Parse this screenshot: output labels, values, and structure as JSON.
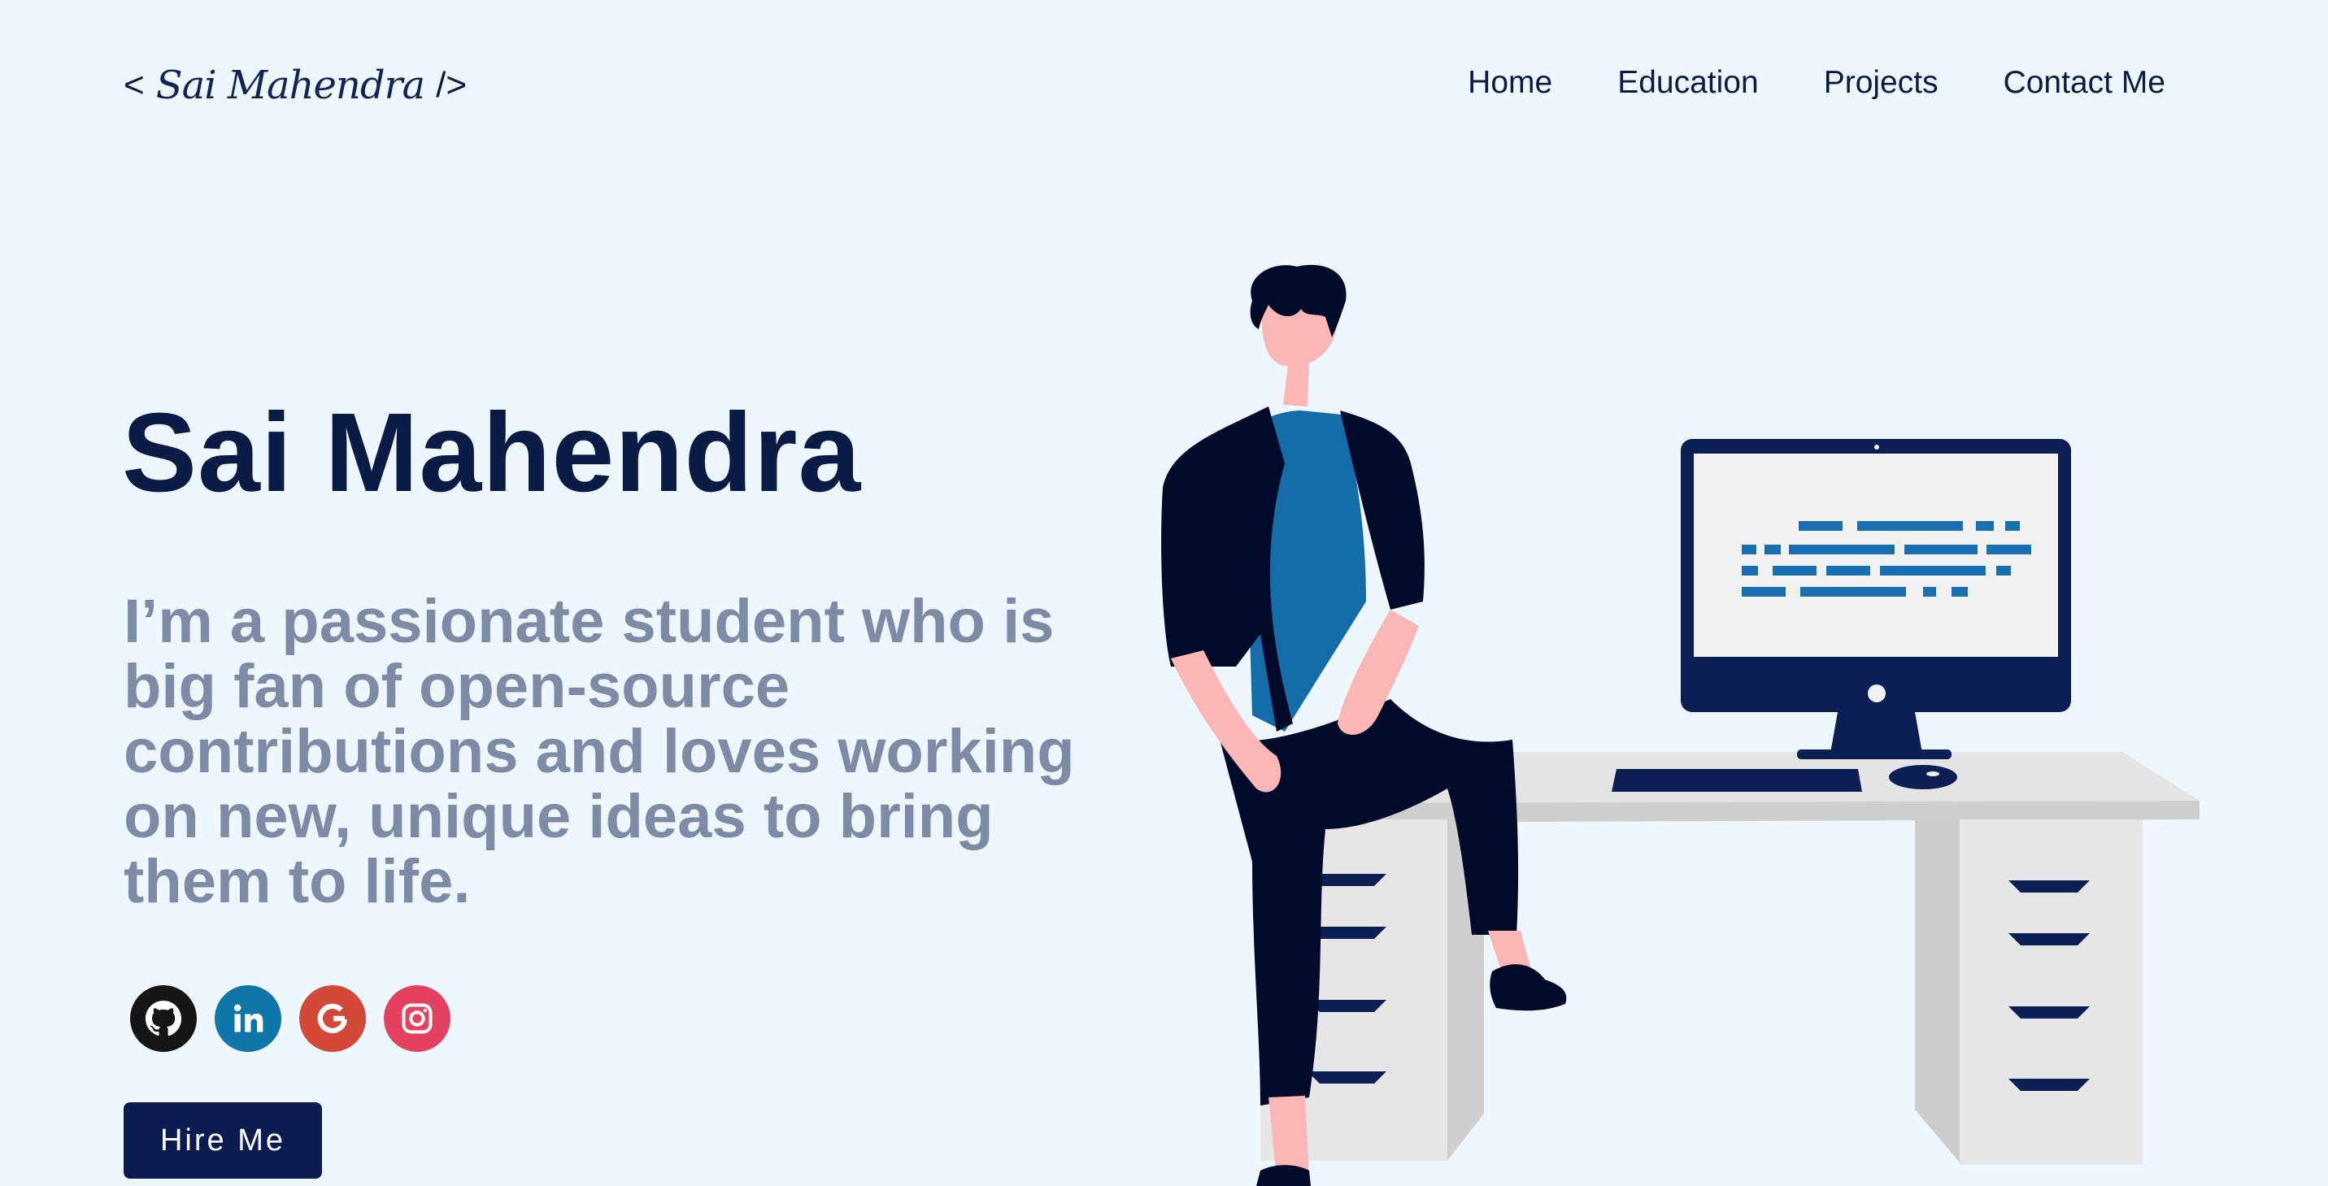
{
  "header": {
    "logo": {
      "open_bracket": "<",
      "signature": "Sai Mahendra",
      "close_bracket": "/>"
    },
    "nav": [
      {
        "label": "Home"
      },
      {
        "label": "Education"
      },
      {
        "label": "Projects"
      },
      {
        "label": "Contact Me"
      }
    ]
  },
  "hero": {
    "name": "Sai Mahendra",
    "bio": "I’m a passionate student who is big fan of open-source contributions and loves working on new, unique ideas to bring them to life.",
    "socials": [
      {
        "icon": "github-icon",
        "color": "#151515"
      },
      {
        "icon": "linkedin-icon",
        "color": "#0e76a8"
      },
      {
        "icon": "google-icon",
        "color": "#d34836"
      },
      {
        "icon": "instagram-icon",
        "color": "#e4405f"
      }
    ],
    "cta_label": "Hire Me"
  },
  "colors": {
    "background": "#edf7fd",
    "primary": "#0a1c46",
    "muted_text": "#7e8ba7",
    "button": "#0a1c52"
  },
  "illustration": {
    "screen_code_color": "#1a6fb0"
  }
}
